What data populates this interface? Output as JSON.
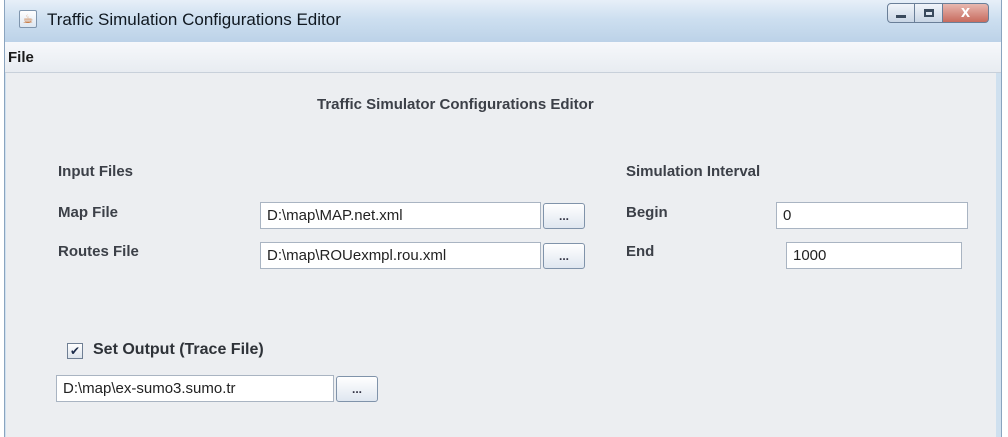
{
  "window": {
    "title": "Traffic Simulation Configurations Editor",
    "controls": {
      "minimize": "minimize",
      "maximize": "maximize",
      "close": "X"
    }
  },
  "menu": {
    "file": "File"
  },
  "main": {
    "heading": "Traffic Simulator Configurations Editor",
    "input_files": {
      "section_label": "Input Files",
      "map_file": {
        "label": "Map File",
        "value": "D:\\map\\MAP.net.xml",
        "browse_label": "..."
      },
      "routes_file": {
        "label": "Routes File",
        "value": "D:\\map\\ROUexmpl.rou.xml",
        "browse_label": "..."
      }
    },
    "simulation_interval": {
      "section_label": "Simulation Interval",
      "begin": {
        "label": "Begin",
        "value": "0"
      },
      "end": {
        "label": "End",
        "value": "1000"
      }
    },
    "output": {
      "checkbox_label": "Set Output (Trace File)",
      "checked": true,
      "check_mark": "✔",
      "value": "D:\\map\\ex-sumo3.sumo.tr",
      "browse_label": "..."
    }
  },
  "icons": {
    "app": "java-coffee-cup-icon"
  }
}
